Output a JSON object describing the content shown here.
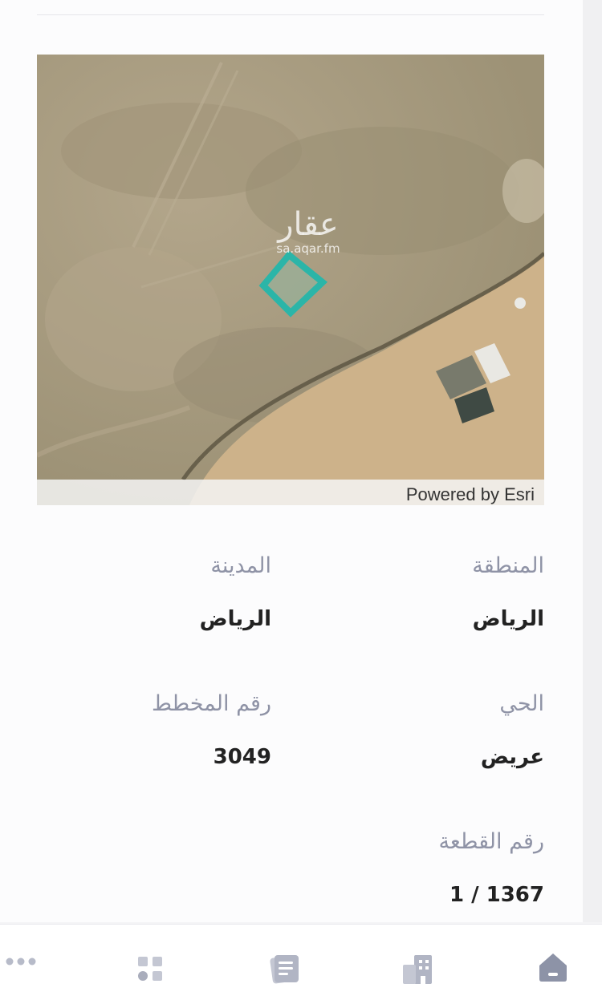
{
  "map": {
    "watermark_brand": "عقار",
    "watermark_url": "sa.aqar.fm",
    "attribution": "Powered by Esri"
  },
  "details": {
    "region_label": "المنطقة",
    "region_value": "الرياض",
    "city_label": "المدينة",
    "city_value": "الرياض",
    "district_label": "الحي",
    "district_value": "عريض",
    "plan_label": "رقم المخطط",
    "plan_value": "3049",
    "plot_label": "رقم القطعة",
    "plot_value": "1 / 1367"
  },
  "nav": {
    "icons": [
      "home-icon",
      "buildings-icon",
      "listings-icon",
      "apps-grid-icon",
      "more-icon"
    ],
    "active_color": "#8d93a7",
    "icon_color": "#b7bbc9"
  },
  "colors": {
    "parcel_outline": "#2bb5a8",
    "label_text": "#8f93a6",
    "value_text": "#222222"
  }
}
